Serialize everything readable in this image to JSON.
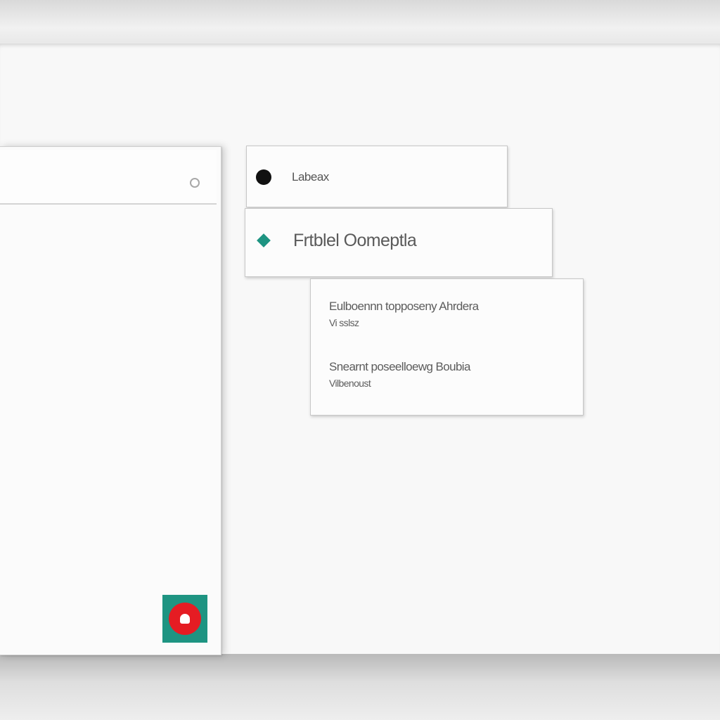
{
  "cards": {
    "top": {
      "label": "Labeax"
    },
    "middle": {
      "label": "Frtblel Oomeptla"
    },
    "detail": {
      "entries": [
        {
          "title": "Eulboennn topposeny Ahrdera",
          "subtitle": "Vi sslsz"
        },
        {
          "title": "Snearnt poseelloewg Boubia",
          "subtitle": "Vilbenoust"
        }
      ]
    }
  },
  "icons": {
    "header_control": "radio-icon",
    "top_card": "dot-icon",
    "middle_card": "diamond-icon",
    "fab": "bell-icon"
  },
  "colors": {
    "accent": "#1e9482",
    "fab_ring": "#e51c23",
    "dot": "#111111"
  }
}
